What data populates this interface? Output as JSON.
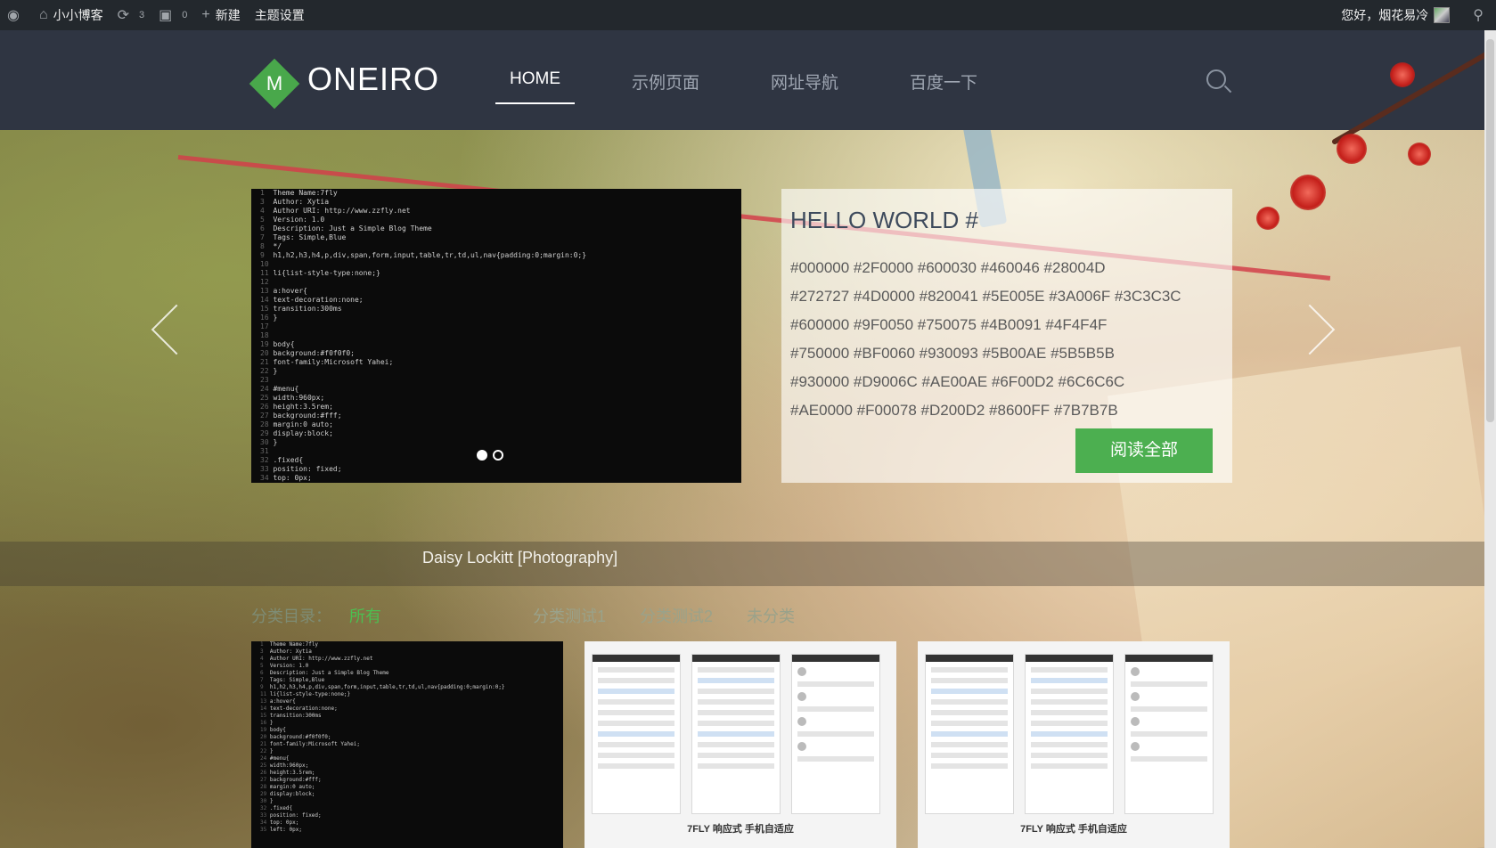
{
  "adminbar": {
    "wp_icon": "wordpress-icon",
    "site_name": "小小博客",
    "updates_count": "3",
    "comments_count": "0",
    "new_label": "新建",
    "theme_settings": "主题设置",
    "greeting": "您好，烟花易冷"
  },
  "header": {
    "logo_letter": "M",
    "logo_text": "ONEIRO",
    "nav": [
      "HOME",
      "示例页面",
      "网址导航",
      "百度一下"
    ]
  },
  "slider": {
    "title": "HELLO WORLD #",
    "body_lines": [
      "#000000 #2F0000 #600030 #460046 #28004D",
      "#272727 #4D0000 #820041 #5E005E #3A006F #3C3C3C",
      "#600000 #9F0050 #750075 #4B0091 #4F4F4F",
      "#750000 #BF0060 #930093 #5B00AE #5B5B5B",
      "#930000 #D9006C #AE00AE #6F00D2 #6C6C6C",
      "#AE0000 #F00078 #D200D2 #8600FF #7B7B7B"
    ],
    "read_more": "阅读全部"
  },
  "credit": "Daisy Lockitt [Photography]",
  "categories": {
    "label": "分类目录：",
    "all": "所有",
    "items": [
      "分类测试1",
      "分类测试2",
      "未分类"
    ]
  },
  "thumbnails": {
    "caption": "7FLY 响应式 手机自适应"
  },
  "colors": {
    "accent_green": "#4caf50",
    "header_bg": "#2f3542",
    "adminbar_bg": "#23282d"
  }
}
